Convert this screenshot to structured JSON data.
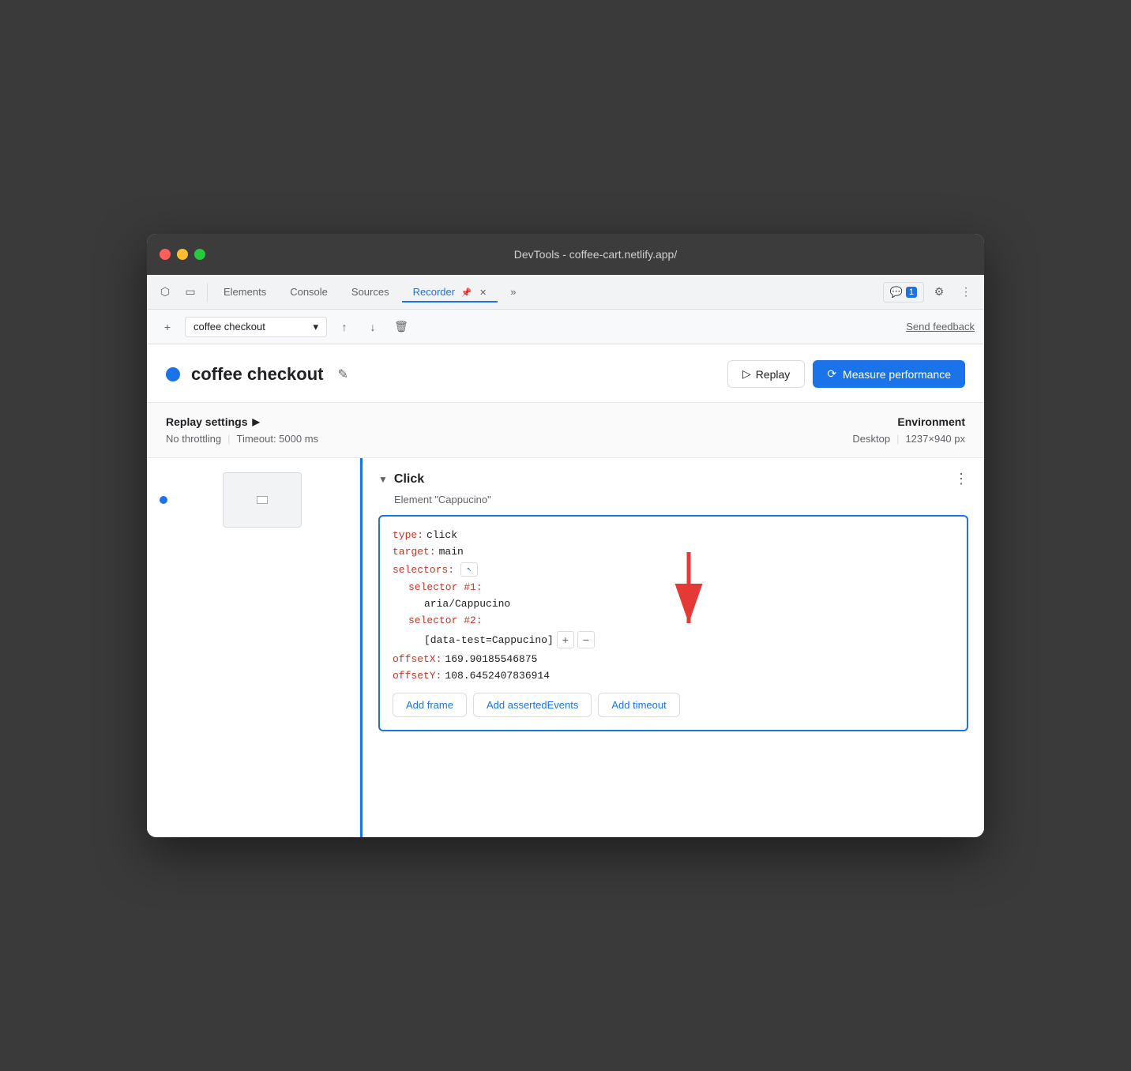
{
  "titlebar": {
    "title": "DevTools - coffee-cart.netlify.app/"
  },
  "tabs": {
    "items": [
      {
        "label": "Elements",
        "active": false
      },
      {
        "label": "Console",
        "active": false
      },
      {
        "label": "Sources",
        "active": false
      },
      {
        "label": "Recorder",
        "active": true
      },
      {
        "label": "»",
        "active": false
      }
    ],
    "badge_label": "1",
    "settings_icon": "⚙",
    "more_icon": "⋮"
  },
  "toolbar": {
    "add_icon": "+",
    "recording_name": "coffee checkout",
    "dropdown_icon": "▾",
    "export_icon": "↑",
    "import_icon": "↓",
    "delete_icon": "🗑",
    "send_feedback": "Send feedback"
  },
  "recording": {
    "dot_color": "#1a73e8",
    "title": "coffee checkout",
    "edit_icon": "✎",
    "replay_label": "Replay",
    "measure_label": "Measure performance",
    "measure_icon": "⟳"
  },
  "settings": {
    "section_label": "Replay settings",
    "arrow": "▶",
    "throttling": "No throttling",
    "separator": "|",
    "timeout_label": "Timeout: 5000 ms",
    "env_label": "Environment",
    "env_value": "Desktop",
    "env_sep": "|",
    "env_resolution": "1237×940 px"
  },
  "step": {
    "collapse_icon": "▼",
    "type": "Click",
    "element": "Element \"Cappucino\"",
    "more_icon": "⋮",
    "code": {
      "type_key": "type:",
      "type_val": "click",
      "target_key": "target:",
      "target_val": "main",
      "selectors_key": "selectors:",
      "selector_icon": "↖",
      "selector1_key": "selector #1:",
      "selector1_val": "aria/Cappucino",
      "selector2_key": "selector #2:",
      "selector2_val": "[data-test=Cappucino]",
      "offsetX_key": "offsetX:",
      "offsetX_val": "169.90185546875",
      "offsetY_key": "offsetY:",
      "offsetY_val": "108.6452407836914"
    },
    "add_frame_label": "Add frame",
    "add_asserted_label": "Add assertedEvents",
    "add_timeout_label": "Add timeout"
  }
}
